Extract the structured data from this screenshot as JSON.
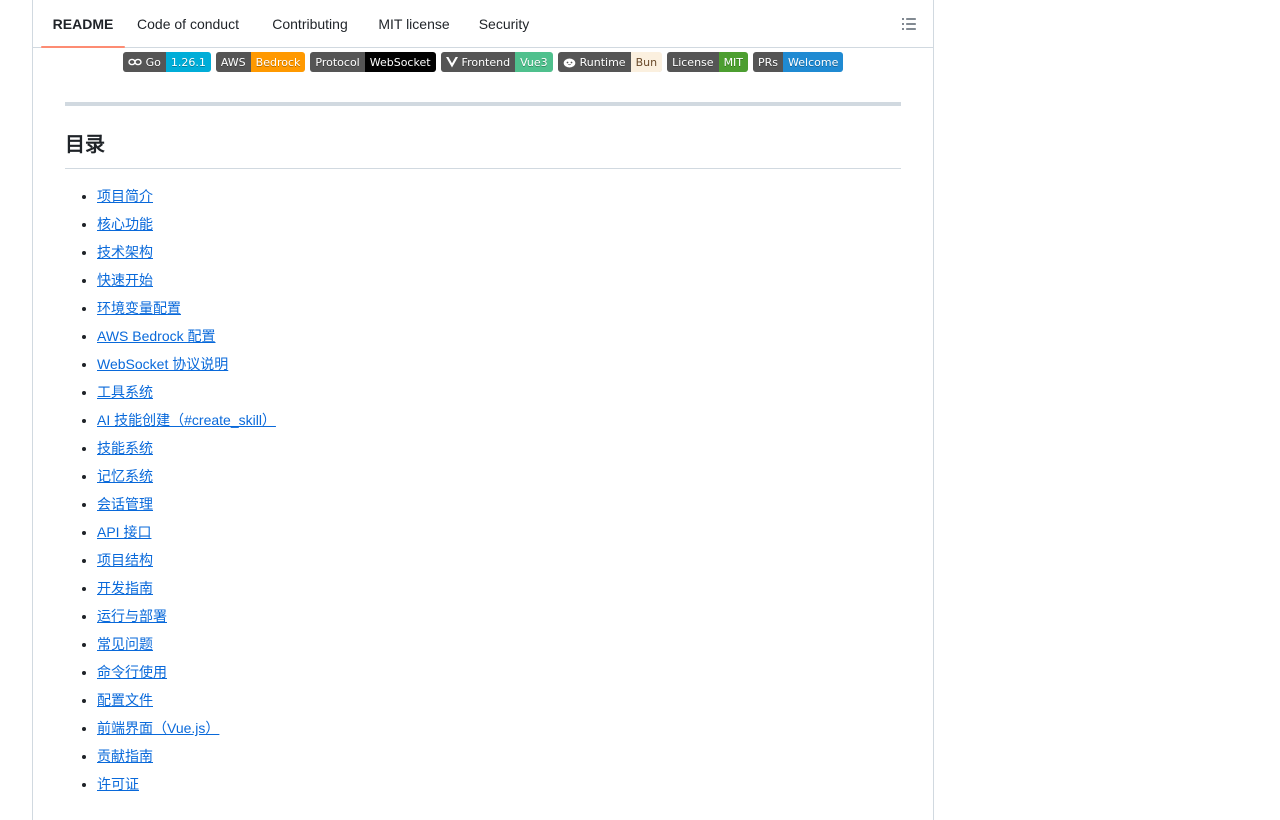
{
  "tabs": [
    {
      "label": "README",
      "active": true
    },
    {
      "label": "Code of conduct",
      "active": false
    },
    {
      "label": "Contributing",
      "active": false
    },
    {
      "label": "MIT license",
      "active": false
    },
    {
      "label": "Security",
      "active": false
    }
  ],
  "outline_icon": "list-unordered-icon",
  "badges": [
    {
      "label": "Go",
      "value": "1.26.1",
      "color": "#00add8",
      "icon": "go-icon"
    },
    {
      "label": "AWS",
      "value": "Bedrock",
      "color": "#ff9900",
      "icon": ""
    },
    {
      "label": "Protocol",
      "value": "WebSocket",
      "color": "#010101",
      "icon": ""
    },
    {
      "label": "Frontend",
      "value": "Vue3",
      "color": "#4fc08d",
      "icon": "vue-icon"
    },
    {
      "label": "Runtime",
      "value": "Bun",
      "color": "#fbf0df",
      "value_text_color": "#6a4a2a",
      "icon": "bun-icon"
    },
    {
      "label": "License",
      "value": "MIT",
      "color": "#4c9e30",
      "icon": ""
    },
    {
      "label": "PRs",
      "value": "Welcome",
      "color": "#1f8ad2",
      "icon": ""
    }
  ],
  "heading": "目录",
  "toc": [
    "项目简介",
    "核心功能",
    "技术架构",
    "快速开始",
    "环境变量配置",
    "AWS Bedrock 配置",
    "WebSocket 协议说明",
    "工具系统",
    "AI 技能创建（#create_skill）",
    "技能系统",
    "记忆系统",
    "会话管理",
    "API 接口",
    "项目结构",
    "开发指南",
    "运行与部署",
    "常见问题",
    "命令行使用",
    "配置文件",
    "前端界面（Vue.js）",
    "贡献指南",
    "许可证"
  ]
}
